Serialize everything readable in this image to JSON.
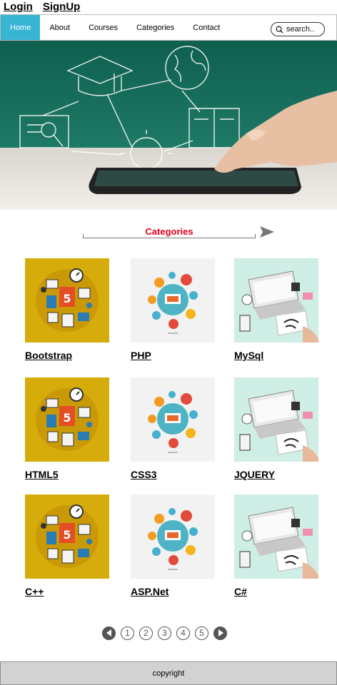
{
  "auth": {
    "login": "Login",
    "signup": "SignUp"
  },
  "nav": {
    "items": [
      {
        "label": "Home",
        "active": true
      },
      {
        "label": "About"
      },
      {
        "label": "Courses"
      },
      {
        "label": "Categories"
      },
      {
        "label": "Contact"
      }
    ],
    "search_placeholder": "search.."
  },
  "hero": {
    "image": "e-learning-hero",
    "icons": [
      "graduation-cap-icon",
      "globe-icon",
      "certificate-icon",
      "lightbulb-icon",
      "book-icon",
      "tablet"
    ]
  },
  "categories": {
    "title": "Categories",
    "items": [
      {
        "label": "Bootstrap",
        "image": "web-dev-yellow"
      },
      {
        "label": "PHP",
        "image": "tech-circle-white"
      },
      {
        "label": "MySql",
        "image": "laptop-desk-mint"
      },
      {
        "label": "HTML5",
        "image": "web-dev-yellow"
      },
      {
        "label": "CSS3",
        "image": "tech-circle-white"
      },
      {
        "label": "JQUERY",
        "image": "laptop-desk-mint"
      },
      {
        "label": "C++",
        "image": "web-dev-yellow"
      },
      {
        "label": "ASP.Net",
        "image": "tech-circle-white"
      },
      {
        "label": "C#",
        "image": "laptop-desk-mint"
      }
    ]
  },
  "pagination": {
    "pages": [
      "1",
      "2",
      "3",
      "4",
      "5"
    ]
  },
  "footer": {
    "text": "copyright"
  },
  "colors": {
    "nav_active": "#37b5d3",
    "heading": "#e0001a",
    "footer_bg": "#d2d2d2"
  }
}
